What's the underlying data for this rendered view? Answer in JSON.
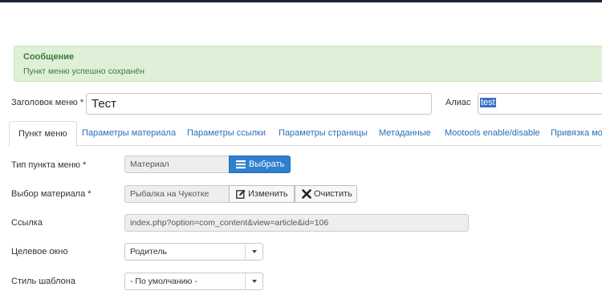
{
  "message": {
    "title": "Сообщение",
    "text": "Пункт меню успешно сохранён"
  },
  "form": {
    "title_label": "Заголовок меню *",
    "title_value": "Тест",
    "alias_label": "Алиас",
    "alias_value": "test"
  },
  "tabs": [
    {
      "label": "Пункт меню",
      "active": true
    },
    {
      "label": "Параметры материала"
    },
    {
      "label": "Параметры ссылки"
    },
    {
      "label": "Параметры страницы"
    },
    {
      "label": "Метаданные"
    },
    {
      "label": "Mootools enable/disable"
    },
    {
      "label": "Привязка модулей"
    }
  ],
  "fields": {
    "type": {
      "label": "Тип пункта меню *",
      "value": "Материал",
      "select_button": "Выбрать",
      "select_icon": "list-icon"
    },
    "article": {
      "label": "Выбор материала *",
      "value": "Рыбалка на Чукотке",
      "edit_button": "Изменить",
      "edit_icon": "edit-icon",
      "clear_button": "Очистить",
      "clear_icon": "close-icon"
    },
    "link": {
      "label": "Ссылка",
      "value": "index.php?option=com_content&view=article&id=106"
    },
    "target": {
      "label": "Целевое окно",
      "value": "Родитель"
    },
    "template_style": {
      "label": "Стиль шаблона",
      "value": "- По умолчанию -"
    }
  },
  "colors": {
    "alert_bg": "#dff0d8",
    "alert_text": "#3c763d",
    "primary": "#2f7fcf",
    "link": "#2a6db7"
  }
}
